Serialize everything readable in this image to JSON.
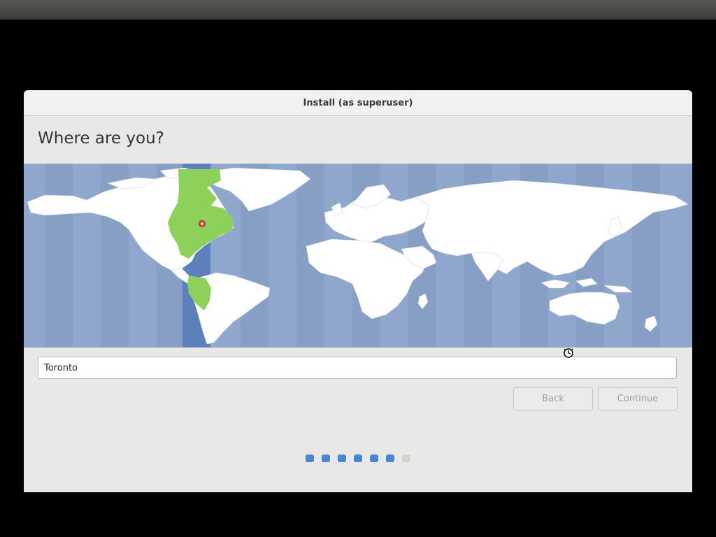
{
  "window": {
    "title": "Install (as superuser)"
  },
  "page": {
    "heading": "Where are you?"
  },
  "location": {
    "value": "Toronto",
    "highlighted_timezone_color": "#8ed15a"
  },
  "buttons": {
    "back": "Back",
    "continue": "Continue"
  },
  "progress": {
    "steps": [
      {
        "state": "done",
        "color": "#4a86cf"
      },
      {
        "state": "done",
        "color": "#4a86cf"
      },
      {
        "state": "done",
        "color": "#4a86cf"
      },
      {
        "state": "done",
        "color": "#4a86cf"
      },
      {
        "state": "done",
        "color": "#4a86cf"
      },
      {
        "state": "done",
        "color": "#4a86cf"
      },
      {
        "state": "pending",
        "color": "#d3d2d0"
      }
    ]
  },
  "colors": {
    "ocean": "#8fa7cc",
    "land": "#ffffff",
    "selected_zone_band": "#5b80bb",
    "marker": "#e04b3a"
  }
}
